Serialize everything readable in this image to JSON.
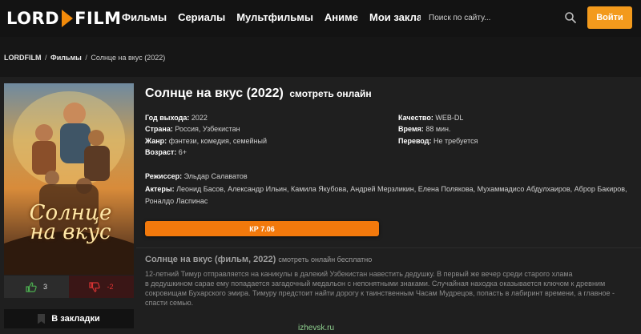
{
  "header": {
    "logo_left": "LORD",
    "logo_right": "FILM",
    "nav": [
      "Фильмы",
      "Сериалы",
      "Мультфильмы",
      "Аниме",
      "Мои закладки"
    ],
    "search_placeholder": "Поиск по сайту...",
    "login_label": "Войти",
    "accent_color": "#f39a1c"
  },
  "breadcrumb": {
    "home": "LORDFILM",
    "section": "Фильмы",
    "current": "Солнце на вкус (2022)",
    "separator": "/"
  },
  "poster": {
    "title_line1": "Солнце",
    "title_line2": "на вкус"
  },
  "votes": {
    "likes": "3",
    "dislikes": "-2"
  },
  "bookmark_label": "В закладки",
  "movie": {
    "title": "Солнце на вкус (2022)",
    "subtitle": "смотреть онлайн",
    "year_label": "Год выхода:",
    "year": "2022",
    "country_label": "Страна:",
    "country": "Россия, Узбекистан",
    "genre_label": "Жанр:",
    "genre": "фэнтези, комедия, семейный",
    "age_label": "Возраст:",
    "age": "6+",
    "quality_label": "Качество:",
    "quality": "WEB-DL",
    "time_label": "Время:",
    "time": "88 мин.",
    "translation_label": "Перевод:",
    "translation": "Не требуется",
    "director_label": "Режиссер:",
    "director": "Эльдар Салаватов",
    "actors_label": "Актеры:",
    "actors_line1": "Леонид Басов, Александр Ильин, Камила Якубова, Андрей Мерзликин, Елена Полякова, Мухаммадисо Абдулхаиров, Аброр Бакиров,",
    "actors_line2": "Роналдо Ласпинас",
    "kp_label": "КР 7.06"
  },
  "description": {
    "title": "Солнце на вкус (фильм, 2022)",
    "title_small": "смотреть онлайн бесплатно",
    "line1": "12-летний Тимур отправляется на каникулы в далекий Узбекистан навестить дедушку. В первый же вечер среди старого хлама",
    "line2": "в дедушкином сарае ему попадается загадочный медальон с непонятными знаками. Случайная находка оказывается ключом к древним",
    "line3": "сокровищам Бухарского эмира. Тимуру предстоит найти дорогу к таинственным Часам Мудрецов, попасть в лабиринт времени, а главное -",
    "line4": "спасти семью."
  },
  "watermark": "izhevsk.ru"
}
